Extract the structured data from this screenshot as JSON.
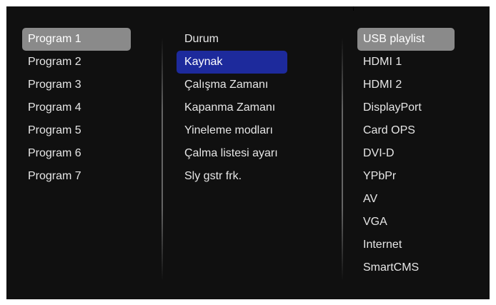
{
  "programs": {
    "items": [
      {
        "label": "Program 1"
      },
      {
        "label": "Program 2"
      },
      {
        "label": "Program 3"
      },
      {
        "label": "Program 4"
      },
      {
        "label": "Program 5"
      },
      {
        "label": "Program 6"
      },
      {
        "label": "Program 7"
      }
    ],
    "selected_index": 0
  },
  "settings": {
    "items": [
      {
        "label": "Durum"
      },
      {
        "label": "Kaynak"
      },
      {
        "label": "Çalışma Zamanı"
      },
      {
        "label": "Kapanma Zamanı"
      },
      {
        "label": "Yineleme modları"
      },
      {
        "label": "Çalma listesi ayarı"
      },
      {
        "label": "Sly gstr frk."
      }
    ],
    "selected_index": 1
  },
  "sources": {
    "items": [
      {
        "label": "USB playlist"
      },
      {
        "label": "HDMI 1"
      },
      {
        "label": "HDMI 2"
      },
      {
        "label": "DisplayPort"
      },
      {
        "label": "Card OPS"
      },
      {
        "label": "DVI-D"
      },
      {
        "label": "YPbPr"
      },
      {
        "label": "AV"
      },
      {
        "label": "VGA"
      },
      {
        "label": "Internet"
      },
      {
        "label": "SmartCMS"
      }
    ],
    "selected_index": 0
  },
  "colors": {
    "background": "#101010",
    "text": "#e6e6e6",
    "highlight_grey": "#8a8a8a",
    "highlight_blue": "#1d2a9c"
  }
}
